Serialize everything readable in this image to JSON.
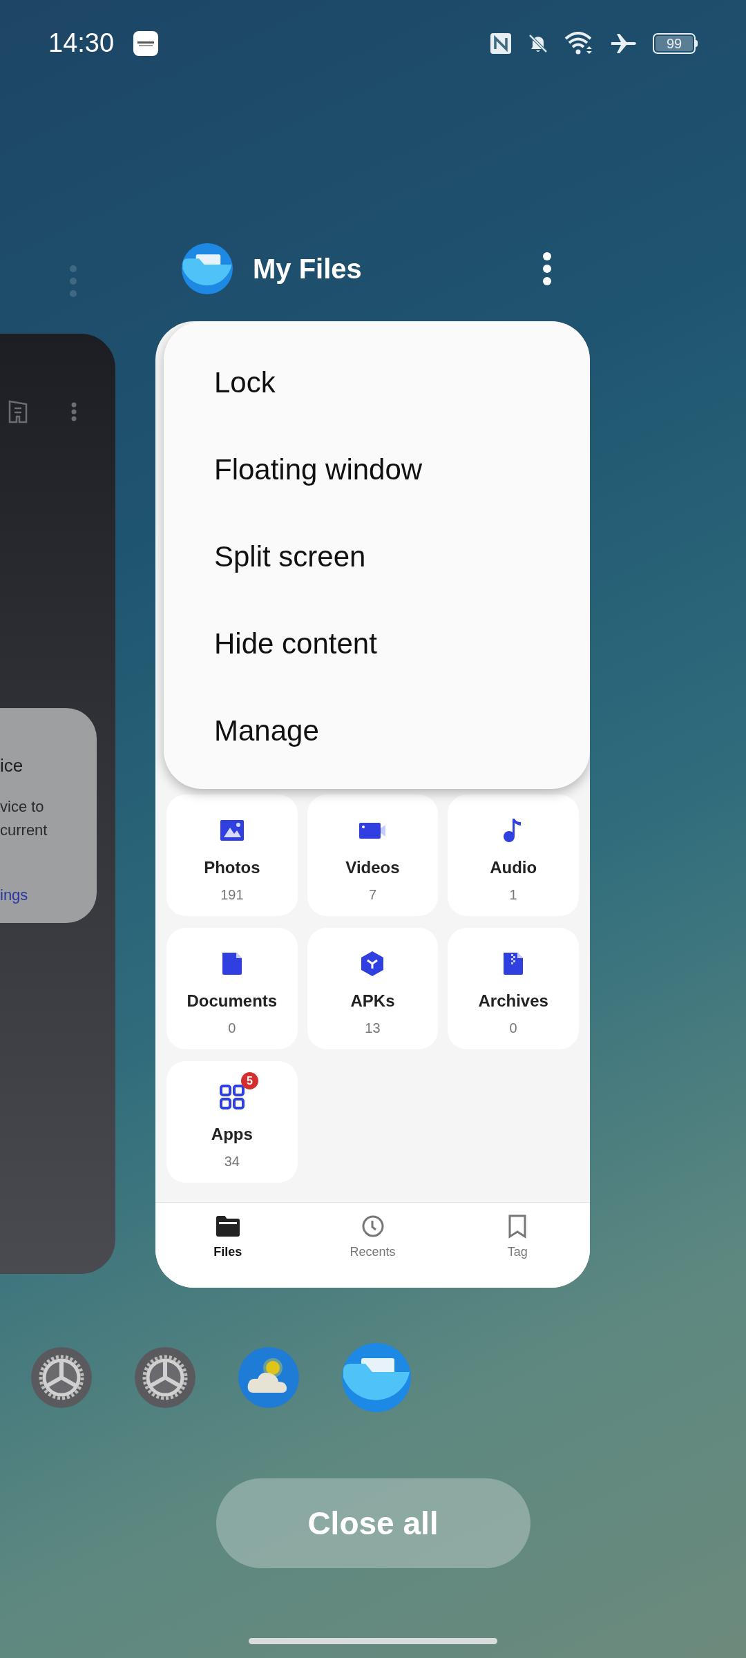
{
  "status_bar": {
    "time": "14:30",
    "battery": "99"
  },
  "background_app": {
    "dialog_title": "ice",
    "dialog_lines": [
      "vice to",
      "current"
    ],
    "dialog_link": "ings"
  },
  "app": {
    "title": "My Files",
    "menu": [
      {
        "label": "Lock"
      },
      {
        "label": "Floating window"
      },
      {
        "label": "Split screen"
      },
      {
        "label": "Hide content"
      },
      {
        "label": "Manage"
      }
    ],
    "categories": [
      {
        "kind": "photos",
        "label": "Photos",
        "count": "191"
      },
      {
        "kind": "videos",
        "label": "Videos",
        "count": "7"
      },
      {
        "kind": "audio",
        "label": "Audio",
        "count": "1"
      },
      {
        "kind": "documents",
        "label": "Documents",
        "count": "0"
      },
      {
        "kind": "apks",
        "label": "APKs",
        "count": "13"
      },
      {
        "kind": "archives",
        "label": "Archives",
        "count": "0"
      },
      {
        "kind": "apps",
        "label": "Apps",
        "count": "34",
        "badge": "5"
      }
    ],
    "tabs": [
      {
        "kind": "files",
        "label": "Files",
        "selected": true
      },
      {
        "kind": "recents",
        "label": "Recents",
        "selected": false
      },
      {
        "kind": "tag",
        "label": "Tag",
        "selected": false
      }
    ]
  },
  "dock": [
    {
      "kind": "settings"
    },
    {
      "kind": "settings"
    },
    {
      "kind": "weather"
    },
    {
      "kind": "files"
    }
  ],
  "close_button": "Close all"
}
